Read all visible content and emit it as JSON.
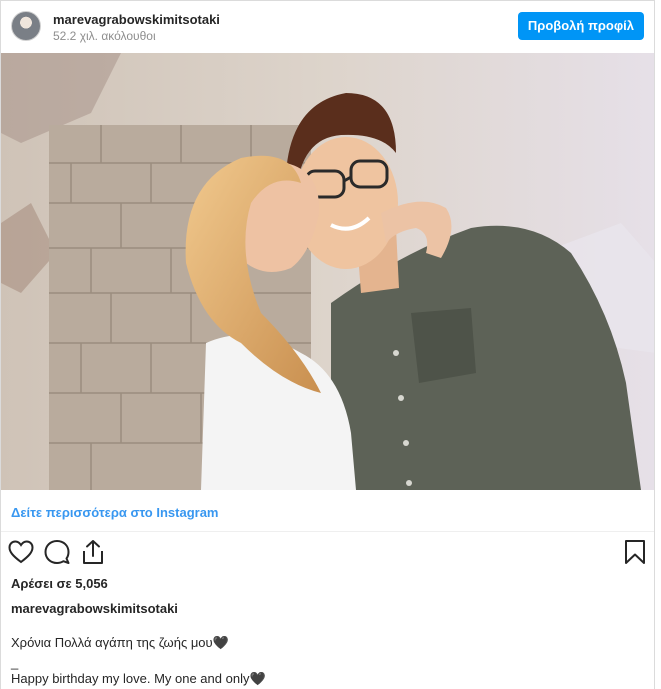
{
  "post": {
    "username": "marevagrabowskimitsotaki",
    "followers": "52.2 χιλ. ακόλουθοι",
    "view_profile_label": "Προβολή προφίλ",
    "see_more_label": "Δείτε περισσότερα στο Instagram",
    "likes": "Αρέσει σε 5,056",
    "caption_author": "marevagrabowskimitsotaki",
    "caption_line1": "Χρόνια Πολλά αγάπη της ζωής μου🖤",
    "caption_line2": "_",
    "caption_line3": "Happy birthday my love. My one and only🖤"
  },
  "icons": {
    "like": "heart-icon",
    "comment": "comment-icon",
    "share": "share-icon",
    "save": "bookmark-icon"
  },
  "colors": {
    "accent": "#0095f6",
    "link": "#3897f0",
    "text": "#262626",
    "muted": "#8e8e8e"
  }
}
